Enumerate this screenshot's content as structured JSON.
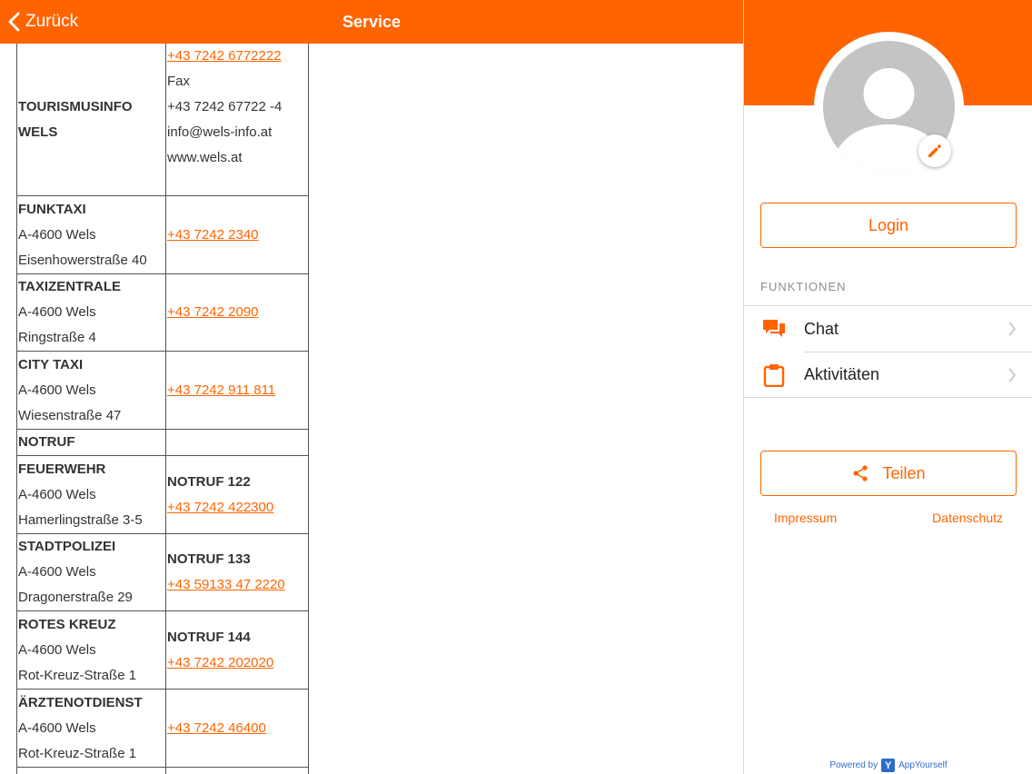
{
  "header": {
    "back_label": "Zurück",
    "title": "Service"
  },
  "table": {
    "tourismus": {
      "name_line1": "TOURISMUSINFO",
      "name_line2": "WELS",
      "phone": "+43 7242 6772222",
      "fax_label": "Fax",
      "fax": "+43 7242 67722 -4",
      "email": "info@wels-info.at",
      "web": "www.wels.at"
    },
    "rows": [
      {
        "name": "FUNKTAXI",
        "city": "A-4600 Wels",
        "street": "Eisenhowerstraße 40",
        "phone": "+43 7242 2340"
      },
      {
        "name": "TAXIZENTRALE",
        "city": "A-4600 Wels",
        "street": "Ringstraße 4",
        "phone": "+43 7242 2090"
      },
      {
        "name": "CITY TAXI",
        "city": "A-4600 Wels",
        "street": "Wiesenstraße 47",
        "phone": "+43 7242 911 811"
      }
    ],
    "notruf_heading": "NOTRUF",
    "emergency": [
      {
        "name": "FEUERWEHR",
        "city": "A-4600 Wels",
        "street": "Hamerlingstraße 3-5",
        "notruf": "NOTRUF 122",
        "phone": "+43 7242 422300"
      },
      {
        "name": "STADTPOLIZEI",
        "city": "A-4600 Wels",
        "street": "Dragonerstraße 29",
        "notruf": "NOTRUF 133",
        "phone": "+43 59133 47 2220"
      },
      {
        "name": "ROTES KREUZ",
        "city": "A-4600 Wels",
        "street": "Rot-Kreuz-Straße 1",
        "notruf": "NOTRUF 144",
        "phone": "+43 7242 202020"
      }
    ],
    "aerzte": {
      "name": "ÄRZTENOTDIENST",
      "city": "A-4600 Wels",
      "street": "Rot-Kreuz-Straße 1",
      "phone": "+43 7242 46400"
    }
  },
  "sidebar": {
    "login_label": "Login",
    "section_label": "FUNKTIONEN",
    "menu": [
      {
        "label": "Chat",
        "icon": "chat-icon"
      },
      {
        "label": "Aktivitäten",
        "icon": "clipboard-icon"
      }
    ],
    "share_label": "Teilen",
    "impressum_label": "Impressum",
    "datenschutz_label": "Datenschutz",
    "powered_label": "Powered by",
    "brand_label": "AppYourself",
    "brand_logo_letter": "Y"
  },
  "colors": {
    "accent": "#ff6400",
    "brand_blue": "#2d6dcc",
    "avatar_gray": "#c4c4c4"
  }
}
